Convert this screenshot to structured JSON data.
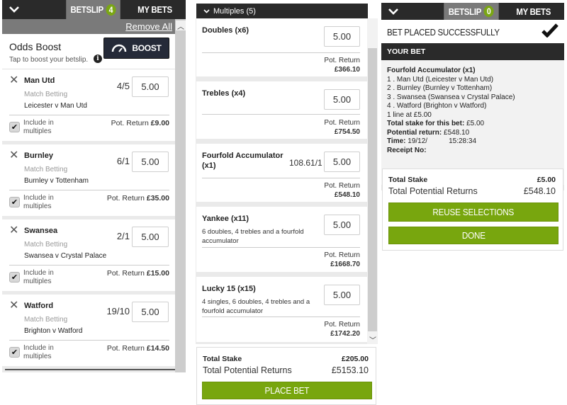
{
  "left_panel": {
    "header": {
      "chevron": "chevron-down-icon",
      "betslip_label": "BETSLIP",
      "betslip_count": "4",
      "mybets_label": "MY BETS"
    },
    "remove_all": "Remove All",
    "odds_boost": {
      "title": "Odds Boost",
      "subtitle": "Tap to boost your betslip.",
      "info_icon": "i",
      "button_label": "BOOST"
    },
    "selections": [
      {
        "name": "Man Utd",
        "market": "Match Betting",
        "event": "Leicester v Man Utd",
        "odds": "4/5",
        "stake": "5.00",
        "include_label": "Include in multiples",
        "included": true,
        "return_label": "Pot. Return",
        "return_value": "£9.00"
      },
      {
        "name": "Burnley",
        "market": "Match Betting",
        "event": "Burnley v Tottenham",
        "odds": "6/1",
        "stake": "5.00",
        "include_label": "Include in multiples",
        "included": true,
        "return_label": "Pot. Return",
        "return_value": "£35.00"
      },
      {
        "name": "Swansea",
        "market": "Match Betting",
        "event": "Swansea v Crystal Palace",
        "odds": "2/1",
        "stake": "5.00",
        "include_label": "Include in multiples",
        "included": true,
        "return_label": "Pot. Return",
        "return_value": "£15.00"
      },
      {
        "name": "Watford",
        "market": "Match Betting",
        "event": "Brighton v Watford",
        "odds": "19/10",
        "stake": "5.00",
        "include_label": "Include in multiples",
        "included": true,
        "return_label": "Pot. Return",
        "return_value": "£14.50"
      }
    ]
  },
  "middle_panel": {
    "header": "Multiples (5)",
    "multiples": [
      {
        "name": "Doubles (x6)",
        "description": "",
        "odds": "",
        "stake": "5.00",
        "return_label": "Pot. Return",
        "return_value": "£366.10"
      },
      {
        "name": "Trebles (x4)",
        "description": "",
        "odds": "",
        "stake": "5.00",
        "return_label": "Pot. Return",
        "return_value": "£754.50"
      },
      {
        "name": "Fourfold Accumulator (x1)",
        "description": "",
        "odds": "108.61/1",
        "stake": "5.00",
        "return_label": "Pot. Return",
        "return_value": "£548.10"
      },
      {
        "name": "Yankee (x11)",
        "description": "6 doubles, 4 trebles and a fourfold accumulator",
        "odds": "",
        "stake": "5.00",
        "return_label": "Pot. Return",
        "return_value": "£1668.70"
      },
      {
        "name": "Lucky 15 (x15)",
        "description": "4 singles, 6 doubles, 4 trebles and a fourfold accumulator",
        "odds": "",
        "stake": "5.00",
        "return_label": "Pot. Return",
        "return_value": "£1742.20"
      }
    ],
    "totals": {
      "stake_label": "Total Stake",
      "stake_value": "£205.00",
      "returns_label": "Total Potential Returns",
      "returns_value": "£5153.10"
    },
    "place_bet": "PLACE BET"
  },
  "right_panel": {
    "header": {
      "chevron": "chevron-down-icon",
      "betslip_label": "BETSLIP",
      "betslip_count": "0",
      "mybets_label": "MY BETS"
    },
    "success_message": "BET PLACED SUCCESSFULLY",
    "your_bet_label": "YOUR BET",
    "receipt": {
      "title": "Fourfold Accumulator (x1)",
      "legs": [
        "1 . Man Utd (Leicester v Man Utd)",
        "2 . Burnley (Burnley v Tottenham)",
        "3 . Swansea (Swansea v Crystal Palace)",
        "4 . Watford (Brighton v Watford)"
      ],
      "lines": "1 line at £5.00",
      "total_stake_label": "Total stake for this bet:",
      "total_stake_value": "£5.00",
      "potential_return_label": "Potential return:",
      "potential_return_value": "£548.10",
      "time_label": "Time:",
      "time_date": "19/12/",
      "time_clock": "15:28:34",
      "receipt_label": "Receipt No:"
    },
    "totals": {
      "stake_label": "Total Stake",
      "stake_value": "£5.00",
      "returns_label": "Total Potential Returns",
      "returns_value": "£548.10"
    },
    "reuse_button": "REUSE SELECTIONS",
    "done_button": "DONE"
  },
  "colors": {
    "accent_green": "#78a60e",
    "dark_bar": "#2a2a2a",
    "tab_active": "#7a7a7a",
    "boost_button": "#252a38"
  }
}
